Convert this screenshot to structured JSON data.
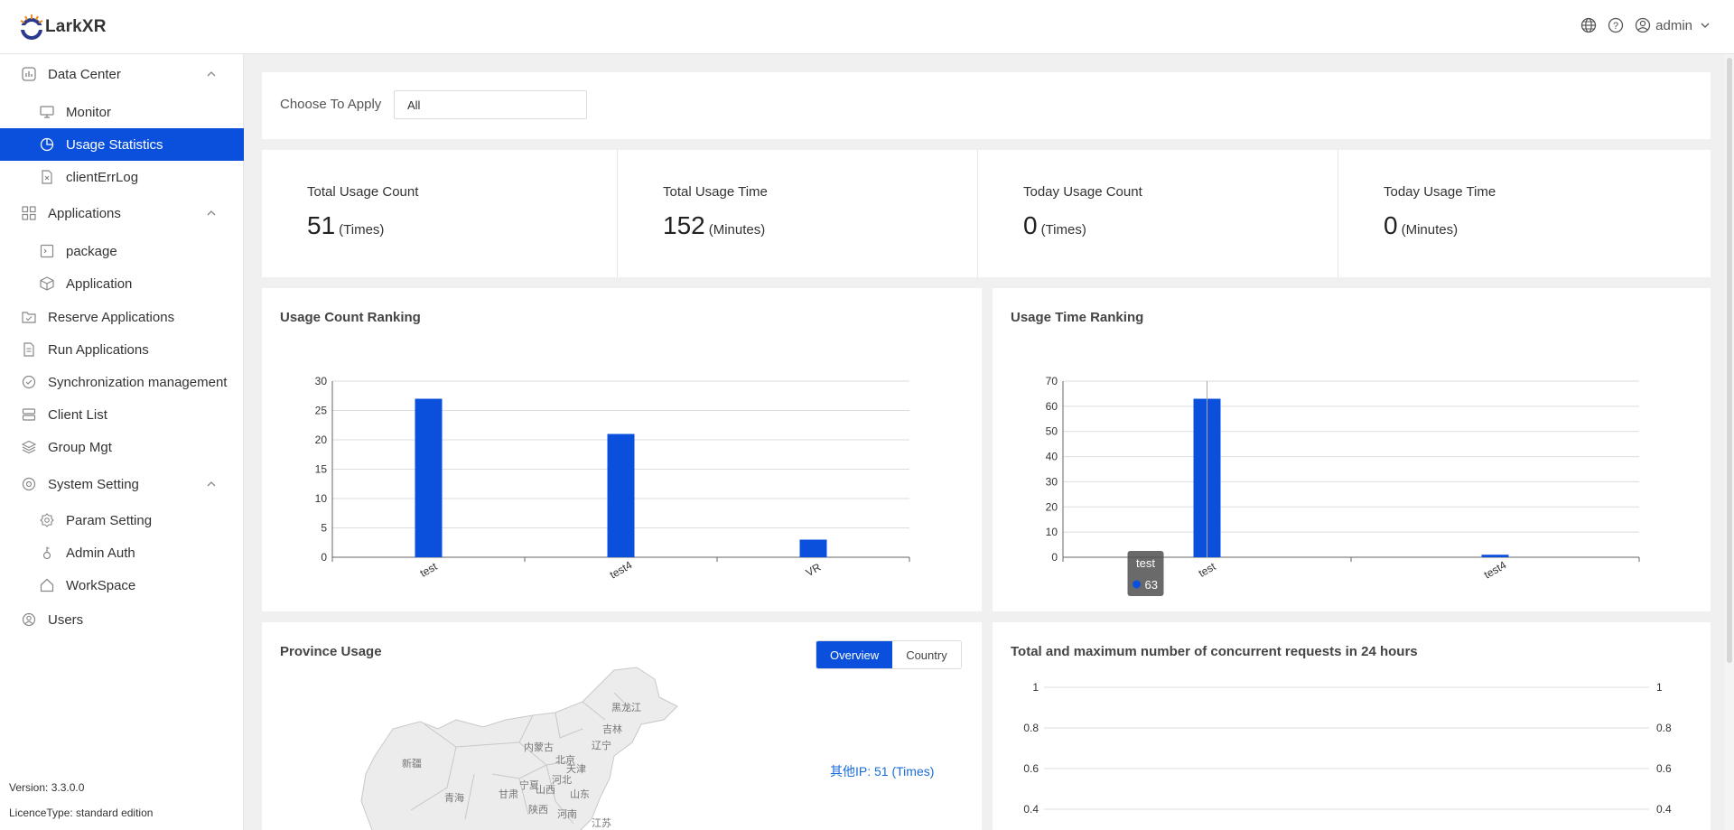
{
  "header": {
    "logo_text": "LarkXR",
    "user": "admin",
    "icons": [
      "globe-icon",
      "help-icon",
      "user-icon",
      "chevron-down-icon"
    ]
  },
  "sidebar": {
    "items": [
      {
        "label": "Data Center",
        "icon": "dashboard-icon",
        "expanded": true
      },
      {
        "label": "Monitor",
        "icon": "monitor-icon"
      },
      {
        "label": "Usage Statistics",
        "icon": "pie-chart-icon",
        "active": true
      },
      {
        "label": "clientErrLog",
        "icon": "file-error-icon"
      },
      {
        "label": "Applications",
        "icon": "apps-icon",
        "expanded": true
      },
      {
        "label": "package",
        "icon": "package-icon"
      },
      {
        "label": "Application",
        "icon": "cube-icon"
      },
      {
        "label": "Reserve Applications",
        "icon": "folder-icon"
      },
      {
        "label": "Run Applications",
        "icon": "document-icon"
      },
      {
        "label": "Synchronization management",
        "icon": "sync-check-icon"
      },
      {
        "label": "Client List",
        "icon": "server-icon"
      },
      {
        "label": "Group Mgt",
        "icon": "layers-icon"
      },
      {
        "label": "System Setting",
        "icon": "settings-icon",
        "expanded": true
      },
      {
        "label": "Param Setting",
        "icon": "gear-icon"
      },
      {
        "label": "Admin Auth",
        "icon": "key-icon"
      },
      {
        "label": "WorkSpace",
        "icon": "home-icon"
      },
      {
        "label": "Users",
        "icon": "user-circle-icon"
      }
    ],
    "version": "Version: 3.3.0.0",
    "licence": "LicenceType: standard edition"
  },
  "filter": {
    "label": "Choose To Apply",
    "value": "All"
  },
  "stats": [
    {
      "title": "Total Usage Count",
      "value": "51",
      "unit": "(Times)"
    },
    {
      "title": "Total Usage Time",
      "value": "152",
      "unit": "(Minutes)"
    },
    {
      "title": "Today Usage Count",
      "value": "0",
      "unit": "(Times)"
    },
    {
      "title": "Today Usage Time",
      "value": "0",
      "unit": "(Minutes)"
    }
  ],
  "province": {
    "title": "Province Usage",
    "tabs": [
      "Overview",
      "Country"
    ],
    "ip_label": "其他IP:",
    "ip_value": "51",
    "ip_unit": "(Times)",
    "map_labels": [
      "黑龙江",
      "吉林",
      "辽宁",
      "内蒙古",
      "北京",
      "天津",
      "新疆",
      "宁夏",
      "河北",
      "青海",
      "甘肃",
      "山西",
      "山东",
      "陕西",
      "河南",
      "江苏"
    ]
  },
  "colors": {
    "accent": "#0a50dc",
    "bar": "#0a50dc"
  },
  "chart_data": [
    {
      "type": "bar",
      "title": "Usage Count Ranking",
      "categories": [
        "test",
        "test4",
        "VR"
      ],
      "values": [
        27,
        21,
        3
      ],
      "ylim": [
        0,
        30
      ],
      "yticks": [
        0,
        5,
        10,
        15,
        20,
        25,
        30
      ],
      "grid": true
    },
    {
      "type": "bar",
      "title": "Usage Time Ranking",
      "categories": [
        "test",
        "test4"
      ],
      "values": [
        63,
        1
      ],
      "ylim": [
        0,
        70
      ],
      "yticks": [
        0,
        10,
        20,
        30,
        40,
        50,
        60,
        70
      ],
      "grid": true,
      "tooltip": {
        "category": "test",
        "value": "63"
      }
    },
    {
      "type": "line",
      "title": "Total and maximum number of concurrent requests in 24 hours",
      "series": [],
      "ylim": [
        0.4,
        1
      ],
      "yticks": [
        "1",
        "0.8",
        "0.6",
        "0.4"
      ],
      "yticks_right": [
        "1",
        "0.8",
        "0.6",
        "0.4"
      ],
      "grid": true
    }
  ]
}
